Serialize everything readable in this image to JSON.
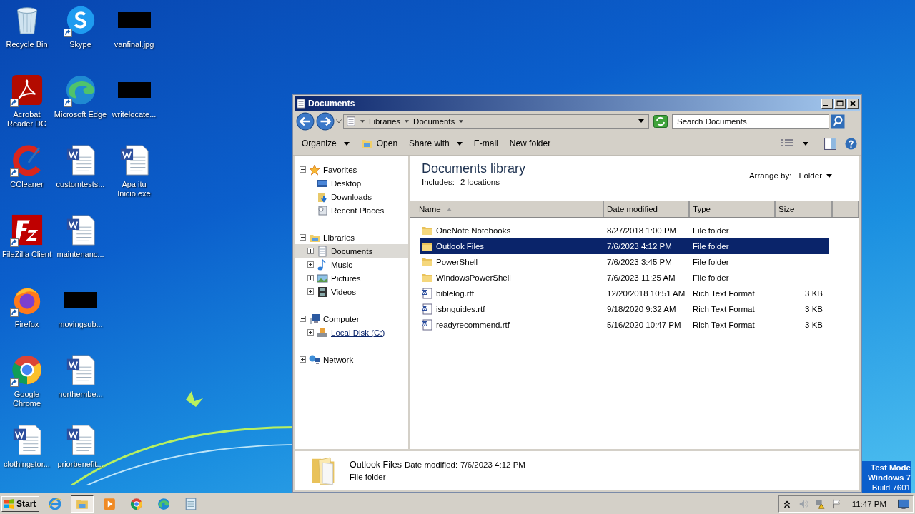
{
  "desktop": {
    "columns": [
      [
        {
          "label": "Recycle Bin",
          "kind": "recycle-bin",
          "shortcut": false
        },
        {
          "label": "Acrobat Reader DC",
          "kind": "acrobat",
          "shortcut": true
        },
        {
          "label": "CCleaner",
          "kind": "ccleaner",
          "shortcut": true
        },
        {
          "label": "FileZilla Client",
          "kind": "filezilla",
          "shortcut": true
        },
        {
          "label": "Firefox",
          "kind": "firefox",
          "shortcut": true
        },
        {
          "label": "Google Chrome",
          "kind": "chrome",
          "shortcut": true
        },
        {
          "label": "clothingstor...",
          "kind": "word",
          "shortcut": false
        }
      ],
      [
        {
          "label": "Skype",
          "kind": "skype",
          "shortcut": true
        },
        {
          "label": "Microsoft Edge",
          "kind": "edge",
          "shortcut": true
        },
        {
          "label": "customtests...",
          "kind": "word",
          "shortcut": false
        },
        {
          "label": "maintenanc...",
          "kind": "word",
          "shortcut": false
        },
        {
          "label": "movingsub...",
          "kind": "black-thumbnail",
          "shortcut": false
        },
        {
          "label": "northernbe...",
          "kind": "word",
          "shortcut": false
        },
        {
          "label": "priorbenefit...",
          "kind": "word",
          "shortcut": false
        }
      ],
      [
        {
          "label": "vanfinal.jpg",
          "kind": "black-thumbnail",
          "shortcut": false
        },
        {
          "label": "writelocate...",
          "kind": "black-thumbnail",
          "shortcut": false
        },
        {
          "label": "Apa itu Inicio.exe",
          "kind": "word-big",
          "shortcut": false
        }
      ]
    ]
  },
  "window": {
    "title": "Documents",
    "breadcrumb": [
      "Libraries",
      "Documents"
    ],
    "search": {
      "placeholder": "Search Documents"
    },
    "toolbar": [
      {
        "label": "Organize",
        "dropdown": true,
        "kind": "plain"
      },
      {
        "label": "Open",
        "dropdown": false,
        "kind": "open"
      },
      {
        "label": "Share with",
        "dropdown": true,
        "kind": "plain"
      },
      {
        "label": "E-mail",
        "dropdown": false,
        "kind": "plain"
      },
      {
        "label": "New folder",
        "dropdown": false,
        "kind": "plain"
      }
    ],
    "navigation": [
      {
        "label": "Favorites",
        "kind": "star",
        "expanded": true,
        "selected": false,
        "hovered": false,
        "children": [
          {
            "label": "Desktop",
            "kind": "desktop",
            "selected": false,
            "hovered": false
          },
          {
            "label": "Downloads",
            "kind": "downloads",
            "selected": false,
            "hovered": false
          },
          {
            "label": "Recent Places",
            "kind": "recent",
            "selected": false,
            "hovered": false
          }
        ]
      },
      {
        "label": "Libraries",
        "kind": "libraries",
        "expanded": true,
        "selected": false,
        "hovered": false,
        "children": [
          {
            "label": "Documents",
            "kind": "documents",
            "expanded": false,
            "selected": true,
            "hovered": false
          },
          {
            "label": "Music",
            "kind": "music",
            "expanded": false,
            "selected": false,
            "hovered": false
          },
          {
            "label": "Pictures",
            "kind": "pictures",
            "expanded": false,
            "selected": false,
            "hovered": false
          },
          {
            "label": "Videos",
            "kind": "videos",
            "expanded": false,
            "selected": false,
            "hovered": false
          }
        ]
      },
      {
        "label": "Computer",
        "kind": "computer",
        "expanded": true,
        "selected": false,
        "hovered": false,
        "children": [
          {
            "label": "Local Disk (C:)",
            "kind": "disk",
            "expanded": false,
            "selected": false,
            "hovered": true
          }
        ]
      },
      {
        "label": "Network",
        "kind": "network",
        "expanded": false,
        "selected": false,
        "hovered": false
      }
    ],
    "library": {
      "title": "Documents library",
      "includes": "Includes:",
      "locations": "2 locations",
      "arrange_label": "Arrange by:",
      "arrange_value": "Folder"
    },
    "columns": [
      {
        "label": "Name",
        "sorted": true
      },
      {
        "label": "Date modified",
        "sorted": false
      },
      {
        "label": "Type",
        "sorted": false
      },
      {
        "label": "Size",
        "sorted": false
      }
    ],
    "files": [
      {
        "name": "OneNote Notebooks",
        "date": "8/27/2018 1:00 PM",
        "type": "File folder",
        "kind": "folder",
        "selected": false
      },
      {
        "name": "Outlook Files",
        "date": "7/6/2023 4:12 PM",
        "type": "File folder",
        "kind": "folder",
        "selected": true
      },
      {
        "name": "PowerShell",
        "date": "7/6/2023 3:45 PM",
        "type": "File folder",
        "kind": "folder",
        "selected": false
      },
      {
        "name": "WindowsPowerShell",
        "date": "7/6/2023 11:25 AM",
        "type": "File folder",
        "kind": "folder",
        "selected": false
      },
      {
        "name": "biblelog.rtf",
        "date": "12/20/2018 10:51 AM",
        "type": "Rich Text Format",
        "size": "3 KB",
        "kind": "document",
        "selected": false
      },
      {
        "name": "isbnguides.rtf",
        "date": "9/18/2020 9:32 AM",
        "type": "Rich Text Format",
        "size": "3 KB",
        "kind": "document",
        "selected": false
      },
      {
        "name": "readyrecommend.rtf",
        "date": "5/16/2020 10:47 PM",
        "type": "Rich Text Format",
        "size": "3 KB",
        "kind": "document",
        "selected": false
      }
    ],
    "details": {
      "name": "Outlook Files",
      "date_label": "Date modified:",
      "date": "7/6/2023 4:12 PM",
      "type": "File folder"
    }
  },
  "watermark": {
    "line_1": "Test Mode",
    "line_2": "Windows 7",
    "line_3": "Build 7601"
  },
  "taskbar": {
    "start": "Start",
    "apps": [
      {
        "kind": "ie",
        "selected": false
      },
      {
        "kind": "explorer",
        "selected": true
      },
      {
        "kind": "media",
        "selected": false
      },
      {
        "kind": "chrome",
        "selected": false
      },
      {
        "kind": "edge",
        "selected": false
      },
      {
        "kind": "notepad",
        "selected": false
      }
    ],
    "clock": "11:47 PM"
  }
}
